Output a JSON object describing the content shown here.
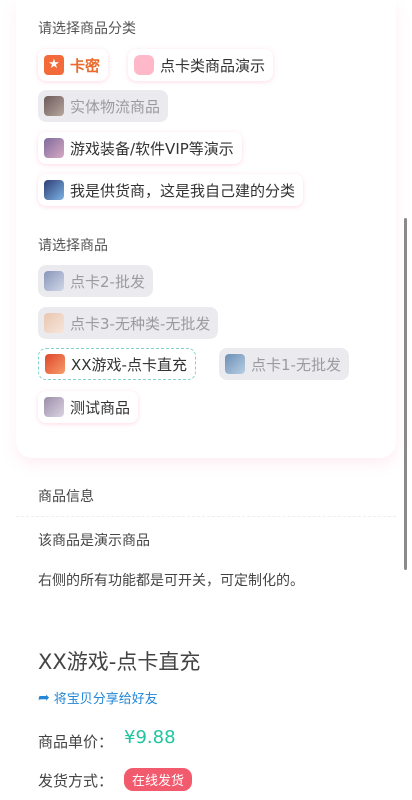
{
  "category_section": {
    "title": "请选择商品分类",
    "items": [
      {
        "label": "卡密",
        "icon": "star-icon",
        "state": "active"
      },
      {
        "label": "点卡类商品演示",
        "icon": "pink-box-icon",
        "state": "normal"
      },
      {
        "label": "实体物流商品",
        "icon": "avatar-icon",
        "state": "disabled"
      },
      {
        "label": "游戏装备/软件VIP等演示",
        "icon": "avatar-icon",
        "state": "normal"
      },
      {
        "label": "我是供货商，这是我自己建的分类",
        "icon": "avatar-icon",
        "state": "normal"
      }
    ]
  },
  "product_section": {
    "title": "请选择商品",
    "items": [
      {
        "label": "点卡2-批发",
        "icon": "avatar-icon",
        "state": "disabled"
      },
      {
        "label": "点卡3-无种类-无批发",
        "icon": "avatar-icon",
        "state": "disabled"
      },
      {
        "label": "XX游戏-点卡直充",
        "icon": "avatar-icon",
        "state": "selected"
      },
      {
        "label": "点卡1-无批发",
        "icon": "avatar-icon",
        "state": "disabled"
      },
      {
        "label": "测试商品",
        "icon": "avatar-icon",
        "state": "normal"
      }
    ]
  },
  "info": {
    "title": "商品信息",
    "line1": "该商品是演示商品",
    "line2": "右侧的所有功能都是可开关，可定制化的。"
  },
  "product": {
    "name": "XX游戏-点卡直充",
    "share": "将宝贝分享给好友",
    "price_label": "商品单价：",
    "price": "¥9.88",
    "ship_label": "发货方式：",
    "ship_value": "在线发货"
  },
  "colors": {
    "accent_orange": "#ea6b2d",
    "price_green": "#20c5a0",
    "share_blue": "#2386d6",
    "badge_red": "#f25a6e"
  }
}
